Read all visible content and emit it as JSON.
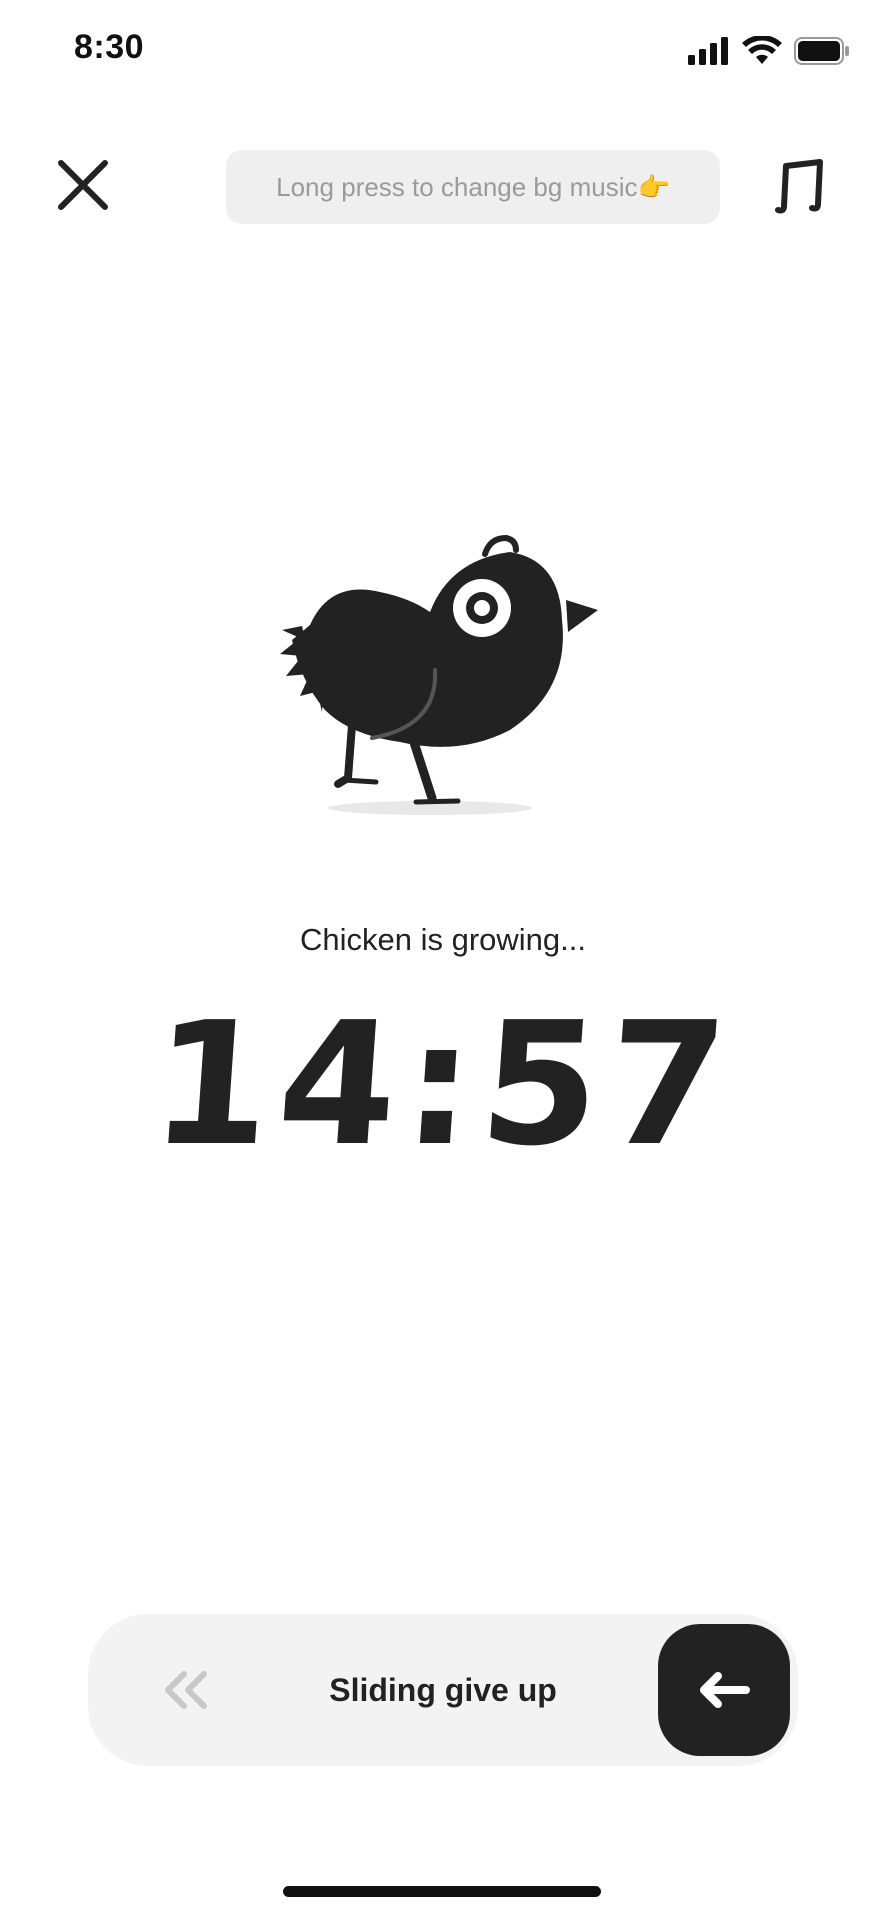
{
  "status_bar": {
    "time": "8:30",
    "icons": [
      "cellular-signal-icon",
      "wifi-icon",
      "battery-icon"
    ]
  },
  "top_bar": {
    "close_icon": "close-icon",
    "tooltip_text": "Long press to change bg music👉",
    "music_icon": "music-note-icon"
  },
  "main": {
    "illustration": "chicken-illustration",
    "status_text": "Chicken is growing...",
    "timer": "14:57"
  },
  "give_up_slider": {
    "label": "Sliding give up",
    "chevron_icon": "double-chevron-left-icon",
    "knob_icon": "arrow-left-icon"
  },
  "colors": {
    "background": "#ffffff",
    "primary": "#222222",
    "tooltip_bg": "#efefef",
    "tooltip_text": "#9a9a9a",
    "slider_bg": "#f3f3f3"
  }
}
